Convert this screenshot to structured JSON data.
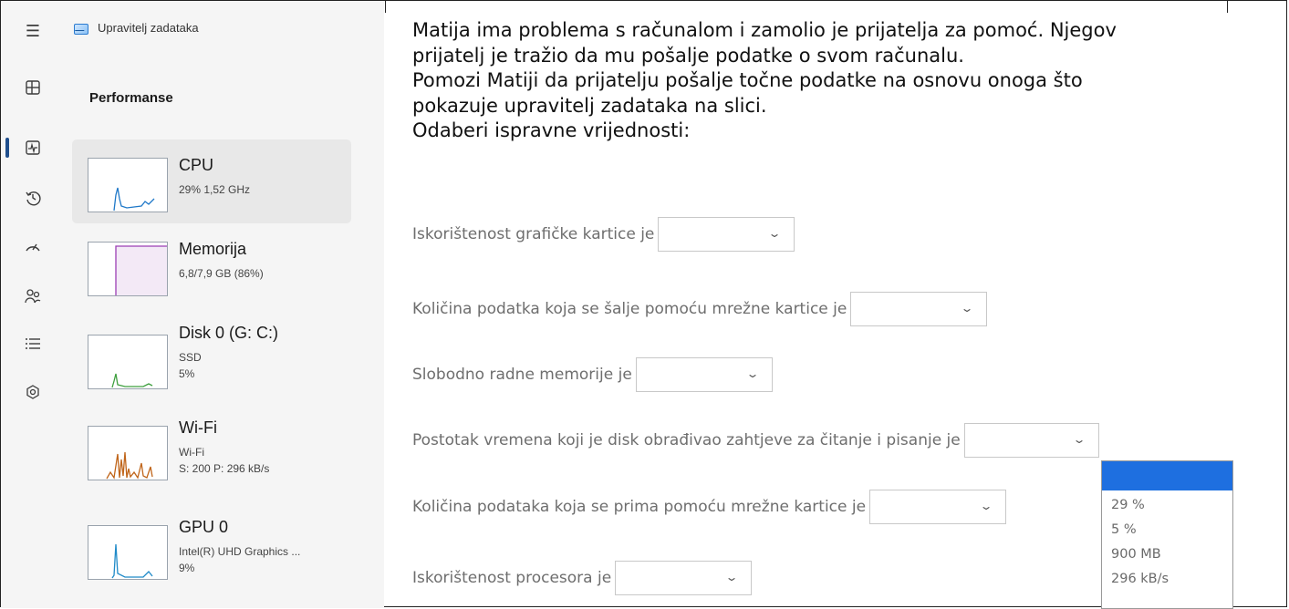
{
  "task_manager": {
    "app_title": "Upravitelj zadataka",
    "section_title": "Performanse",
    "nav_icons": [
      "hamburger-icon",
      "processes-icon",
      "performance-icon",
      "history-icon",
      "startup-icon",
      "users-icon",
      "details-icon",
      "services-icon"
    ],
    "tiles": [
      {
        "name": "CPU",
        "sub1": "29% 1,52 GHz",
        "sub2": "",
        "sub3": "",
        "color": "#1f78c8"
      },
      {
        "name": "Memorija",
        "sub1": "6,8/7,9 GB (86%)",
        "sub2": "",
        "sub3": "",
        "color": "#9b3fb5"
      },
      {
        "name": "Disk 0 (G: C:)",
        "sub1": "SSD",
        "sub2": "5%",
        "sub3": "",
        "color": "#3e9f3e"
      },
      {
        "name": "Wi-Fi",
        "sub1": "Wi-Fi",
        "sub2": "S: 200 P: 296 kB/s",
        "sub3": "",
        "color": "#c0651a"
      },
      {
        "name": "GPU 0",
        "sub1": "Intel(R) UHD Graphics ...",
        "sub2": "9%",
        "sub3": "",
        "color": "#1f8ac8"
      }
    ]
  },
  "intro": {
    "line1": "Matija ima problema s računalom i zamolio je prijatelja za pomoć. Njegov",
    "line2": "prijatelj je tražio da mu pošalje podatke o svom računalu.",
    "line3": "Pomozi Matiji da prijatelju pošalje točne podatke na osnovu onoga što",
    "line4": "pokazuje upravitelj zadataka na slici.",
    "line5": "Odaberi ispravne vrijednosti:"
  },
  "questions": [
    {
      "text": "Iskorištenost grafičke kartice je",
      "value": ""
    },
    {
      "text": "Količina podatka koja se šalje pomoću mrežne kartice je",
      "value": ""
    },
    {
      "text": "Slobodno radne memorije je",
      "value": ""
    },
    {
      "text": "Postotak vremena koji je disk obrađivao zahtjeve za čitanje i pisanje je",
      "value": ""
    },
    {
      "text": "Količina podataka koja se prima pomoću mrežne kartice je",
      "value": ""
    },
    {
      "text": "Iskorištenost procesora je",
      "value": ""
    }
  ],
  "dropdown_options": [
    "",
    "29 %",
    "5 %",
    "900 MB",
    "296 kB/s"
  ],
  "accent_color": "#1e6fe0"
}
